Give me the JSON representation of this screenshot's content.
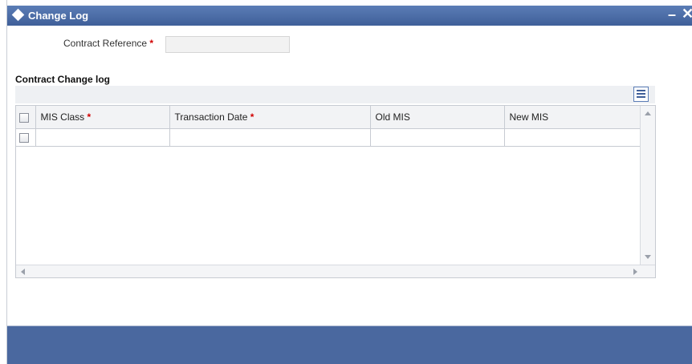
{
  "window": {
    "title": "Change Log",
    "minimize_glyph": "–",
    "close_glyph": "✕"
  },
  "form": {
    "contract_reference_label": "Contract Reference",
    "required_marker": "*",
    "contract_reference_value": ""
  },
  "section": {
    "title": "Contract Change log"
  },
  "grid": {
    "columns": [
      {
        "label": "MIS Class",
        "required": true
      },
      {
        "label": "Transaction Date",
        "required": true
      },
      {
        "label": "Old MIS",
        "required": false
      },
      {
        "label": "New MIS",
        "required": false
      }
    ],
    "rows": [
      {
        "mis_class": "",
        "transaction_date": "",
        "old_mis": "",
        "new_mis": ""
      }
    ]
  },
  "colors": {
    "titlebar": "#4a689f",
    "required": "#d10000",
    "footer": "#4a689f"
  },
  "icons": {
    "title": "diamond-icon",
    "grid_tool": "column-list-icon"
  }
}
